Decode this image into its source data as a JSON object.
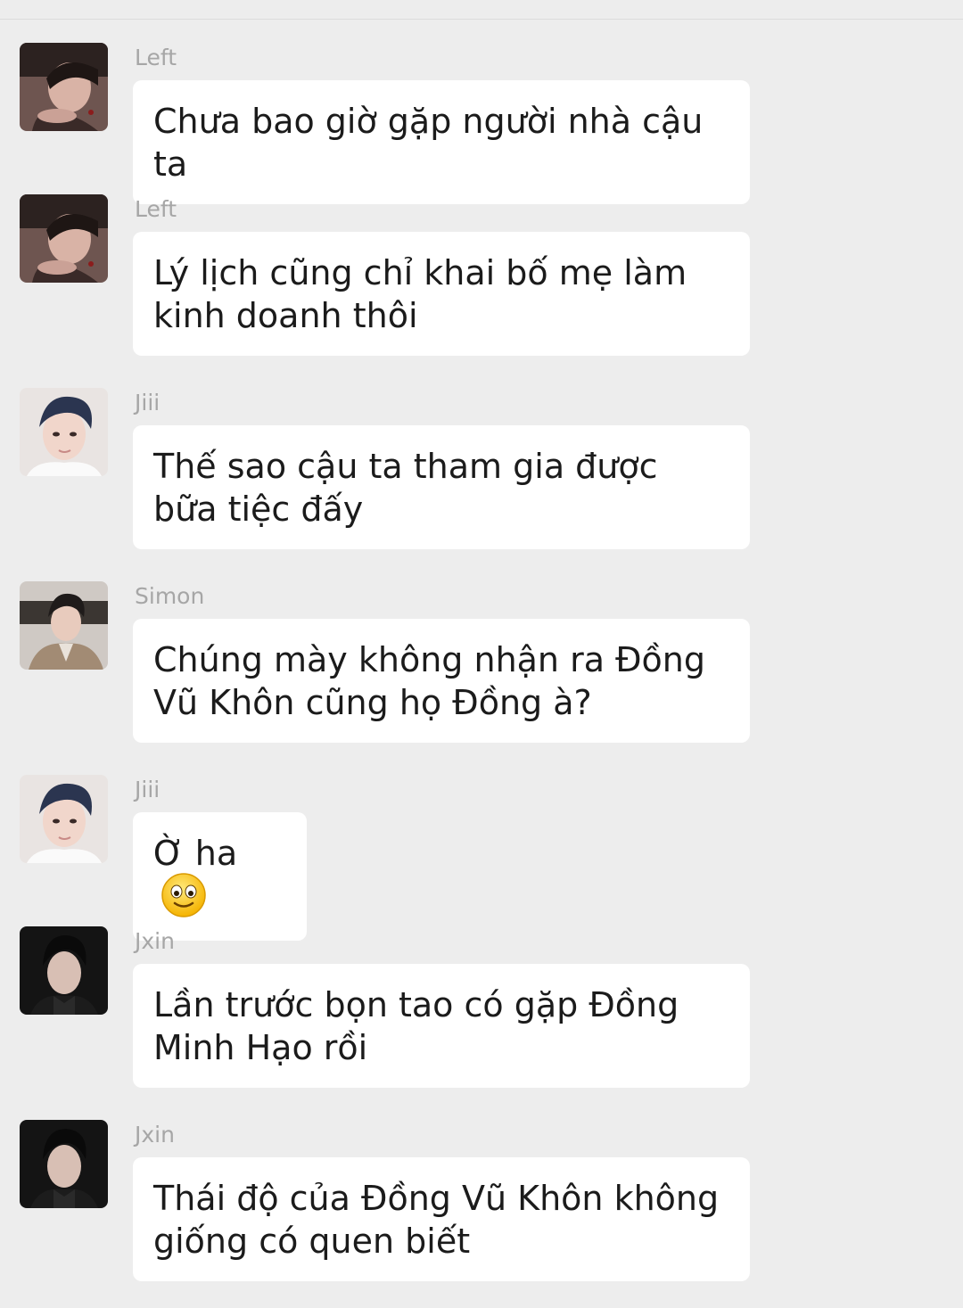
{
  "chat": {
    "messages": [
      {
        "sender": "Left",
        "text": "Chưa bao giờ gặp người nhà cậu ta",
        "avatar": "avatar-left"
      },
      {
        "sender": "Left",
        "text": "Lý lịch cũng chỉ khai bố mẹ làm kinh doanh thôi",
        "avatar": "avatar-left"
      },
      {
        "sender": "Jiii",
        "text": "Thế sao cậu ta tham gia được bữa tiệc đấy",
        "avatar": "avatar-jiii"
      },
      {
        "sender": "Simon",
        "text": "Chúng mày không nhận ra Đồng Vũ Khôn cũng họ Đồng à?",
        "avatar": "avatar-simon"
      },
      {
        "sender": "Jiii",
        "text": "Ờ ha",
        "emoji": "smile-emoji-icon",
        "avatar": "avatar-jiii"
      },
      {
        "sender": "Jxin",
        "text": "Lần trước bọn tao có gặp Đồng Minh Hạo rồi",
        "avatar": "avatar-jxin"
      },
      {
        "sender": "Jxin",
        "text": "Thái độ của Đồng Vũ Khôn không giống có quen biết",
        "avatar": "avatar-jxin"
      }
    ]
  },
  "colors": {
    "background": "#ededed",
    "bubble": "#ffffff",
    "sender_text": "#a6a6a6",
    "message_text": "#1b1b1b"
  }
}
